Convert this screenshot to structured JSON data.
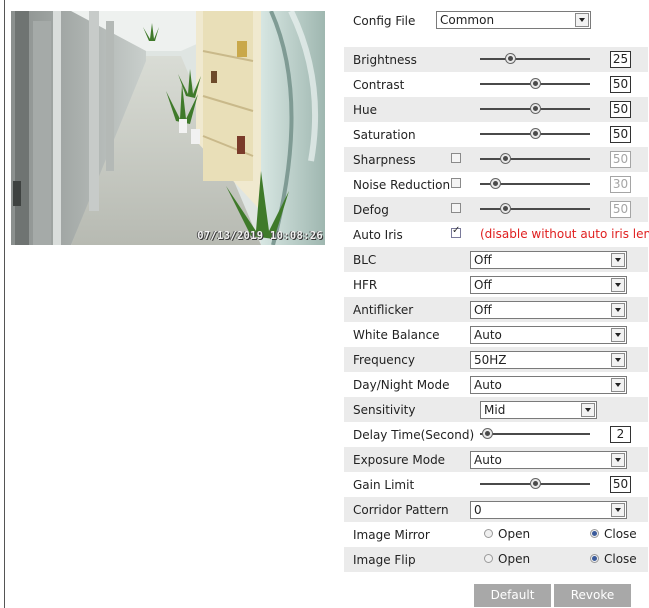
{
  "preview": {
    "timestamp": "07/13/2019 10:08:26"
  },
  "config": {
    "label": "Config File",
    "value": "Common"
  },
  "rows": {
    "brightness": {
      "label": "Brightness",
      "value": "25",
      "level": 0.3
    },
    "contrast": {
      "label": "Contrast",
      "value": "50",
      "level": 0.5
    },
    "hue": {
      "label": "Hue",
      "value": "50",
      "level": 0.5
    },
    "saturation": {
      "label": "Saturation",
      "value": "50",
      "level": 0.5
    },
    "sharpness": {
      "label": "Sharpness",
      "value": "50",
      "checked": false
    },
    "noise_reduction": {
      "label": "Noise Reduction",
      "value": "30",
      "checked": false
    },
    "defog": {
      "label": "Defog",
      "value": "50",
      "checked": false
    },
    "auto_iris": {
      "label": "Auto Iris",
      "checked": true,
      "hint": "(disable without auto iris lens)"
    },
    "blc": {
      "label": "BLC",
      "value": "Off"
    },
    "hfr": {
      "label": "HFR",
      "value": "Off"
    },
    "antiflicker": {
      "label": "Antiflicker",
      "value": "Off"
    },
    "white_balance": {
      "label": "White Balance",
      "value": "Auto"
    },
    "frequency": {
      "label": "Frequency",
      "value": "50HZ"
    },
    "day_night": {
      "label": "Day/Night Mode",
      "value": "Auto"
    },
    "sensitivity": {
      "label": "Sensitivity",
      "value": "Mid"
    },
    "delay_time": {
      "label": "Delay Time(Second)",
      "value": "2"
    },
    "exposure_mode": {
      "label": "Exposure Mode",
      "value": "Auto"
    },
    "gain_limit": {
      "label": "Gain Limit",
      "value": "50"
    },
    "corridor_pattern": {
      "label": "Corridor Pattern",
      "value": "0"
    },
    "image_mirror": {
      "label": "Image Mirror",
      "option_open": "Open",
      "option_close": "Close",
      "selected": "Close"
    },
    "image_flip": {
      "label": "Image Flip",
      "option_open": "Open",
      "option_close": "Close",
      "selected": "Close"
    }
  },
  "buttons": {
    "default": "Default",
    "revoke": "Revoke"
  },
  "colors": {
    "row_shade": "#ebebeb",
    "hint": "#e02020",
    "button": "#a8a8a8"
  }
}
